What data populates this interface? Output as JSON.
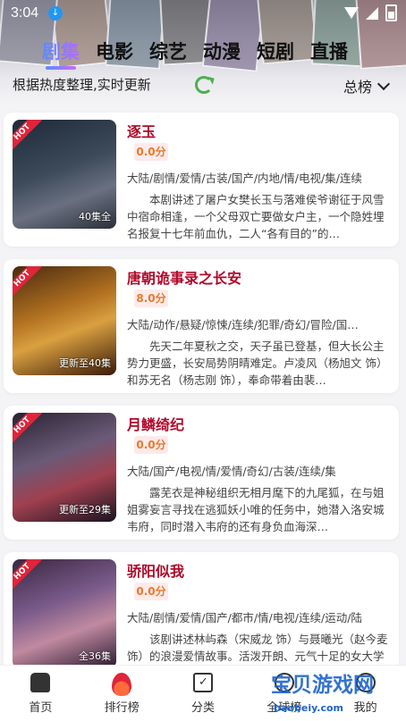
{
  "status_bar": {
    "time": "3:04"
  },
  "tabs": [
    {
      "label": "剧集",
      "active": true
    },
    {
      "label": "电影",
      "active": false
    },
    {
      "label": "综艺",
      "active": false
    },
    {
      "label": "动漫",
      "active": false
    },
    {
      "label": "短剧",
      "active": false
    },
    {
      "label": "直播",
      "active": false
    }
  ],
  "subheader": {
    "note": "根据热度整理,实时更新",
    "rank_select": "总榜"
  },
  "badge_label": "HOT",
  "items": [
    {
      "title": "逐玉",
      "score": "0.0分",
      "episodes": "40集全",
      "tags": "大陆/剧情/爱情/古装/国产/内地/情/电视/集/连续",
      "desc": "本剧讲述了屠户女樊长玉与落难侯爷谢征于风雪中宿命相逢，一个父母双亡要做女户主，一个隐姓埋名报复十七年前血仇，二人“各有目的”的…"
    },
    {
      "title": "唐朝诡事录之长安",
      "score": "8.0分",
      "episodes": "更新至40集",
      "tags": "大陆/动作/悬疑/惊悚/连续/犯罪/奇幻/冒险/国…",
      "desc": "先天二年夏秋之交，天子虽已登基，但大长公主势力更盛，长安局势阴晴难定。卢凌风（杨旭文 饰）和苏无名（杨志刚 饰），奉命带着由裴…"
    },
    {
      "title": "月鳞绮纪",
      "score": "0.0分",
      "episodes": "更新至29集",
      "tags": "大陆/国产/电视/情/爱情/奇幻/古装/连续/集",
      "desc": "露芜衣是神秘组织无相月麾下的九尾狐，在与姐姐雾妄言寻找在逃狐妖小唯的任务中，她潜入洛安城韦府，同时潜入韦府的还有身负血海深…"
    },
    {
      "title": "骄阳似我",
      "score": "0.0分",
      "episodes": "全36集",
      "tags": "大陆/剧情/爱情/国产/都市/情/电视/连续/运动/陆",
      "desc": "该剧讲述林屿森（宋威龙 饰）与聂曦光（赵今麦 饰）的浪漫爱情故事。活泼开朗、元气十足的女大学生聂曦光在实习期…"
    }
  ],
  "bottom_nav": [
    {
      "label": "首页",
      "icon": "home-icon"
    },
    {
      "label": "排行榜",
      "icon": "fire-icon"
    },
    {
      "label": "分类",
      "icon": "calendar-icon"
    },
    {
      "label": "全球榜",
      "icon": "globe-icon"
    },
    {
      "label": "我的",
      "icon": "user-icon"
    }
  ],
  "watermark": {
    "text": "宝贝游戏网",
    "sub": "baobeiy.com"
  },
  "colors": {
    "title": "#b0082a",
    "hot": "#e0243a",
    "score": "#e67a2b",
    "tab_gradient_start": "#5b8dff",
    "tab_gradient_end": "#c76bff"
  }
}
